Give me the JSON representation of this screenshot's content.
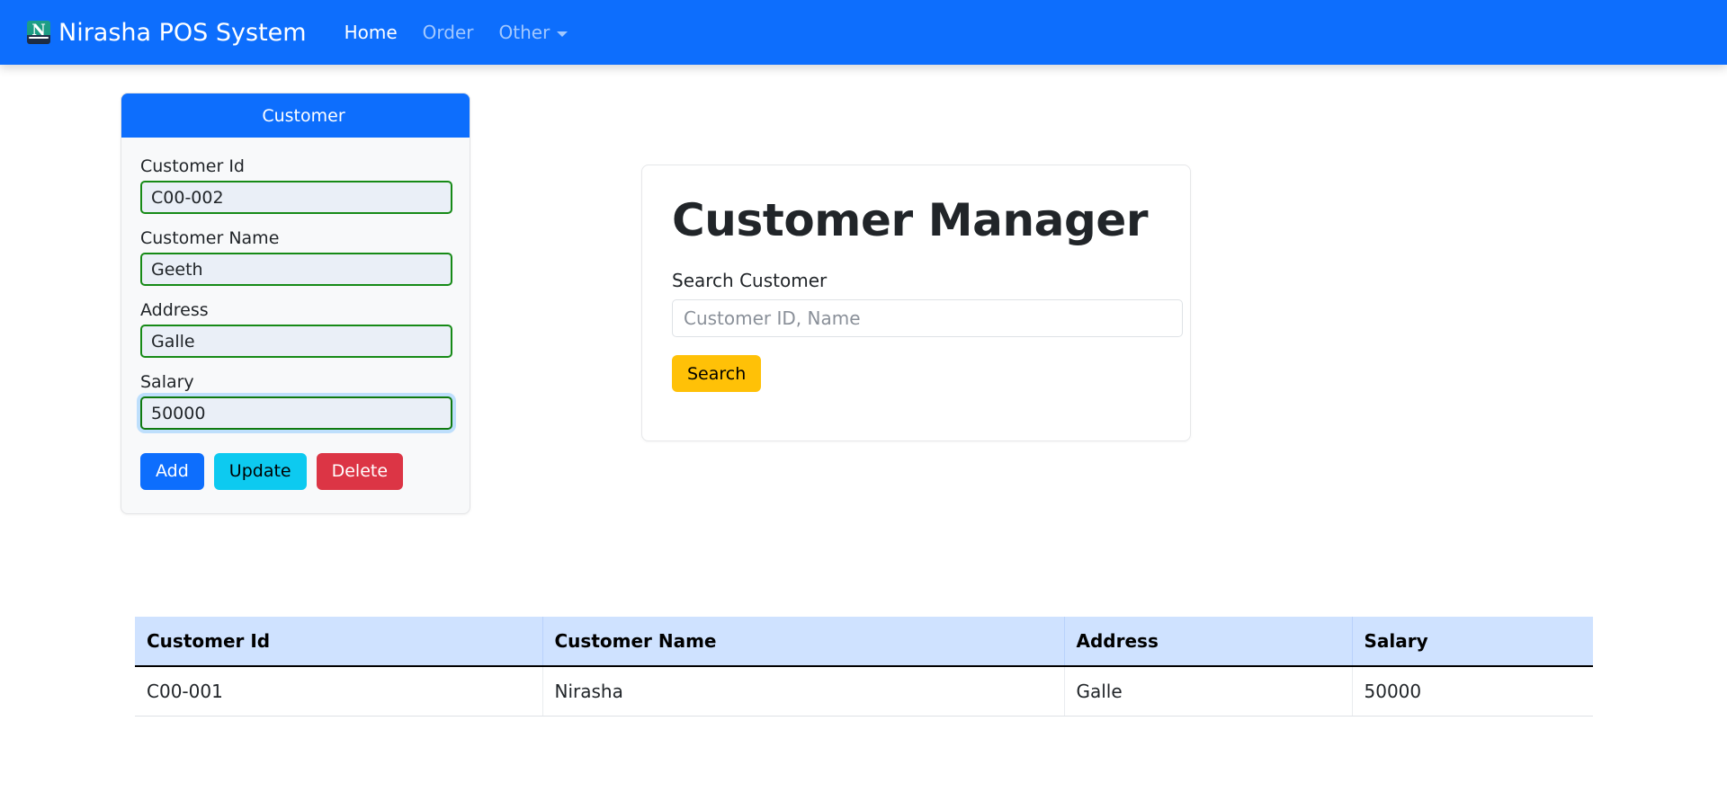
{
  "navbar": {
    "brand": "Nirasha POS System",
    "logo_icon": "logo-n-icon",
    "logo_letter": "N",
    "brand_color": "#0d6efd",
    "links": [
      {
        "label": "Home",
        "active": true,
        "has_caret": false
      },
      {
        "label": "Order",
        "active": false,
        "has_caret": false
      },
      {
        "label": "Other",
        "active": false,
        "has_caret": true
      }
    ]
  },
  "form_card": {
    "header": "Customer",
    "fields": [
      {
        "label": "Customer Id",
        "value": "C00-002",
        "focused": false
      },
      {
        "label": "Customer Name",
        "value": "Geeth",
        "focused": false
      },
      {
        "label": "Address",
        "value": "Galle",
        "focused": false
      },
      {
        "label": "Salary",
        "value": "50000",
        "focused": true
      }
    ],
    "buttons": {
      "add": "Add",
      "update": "Update",
      "delete": "Delete"
    },
    "colors": {
      "add": "#0d6efd",
      "update": "#0dcaf0",
      "delete": "#dc3545",
      "input_border": "#168a16",
      "input_fill": "#eaeff7"
    }
  },
  "manager_card": {
    "title": "Customer Manager",
    "search_label": "Search Customer",
    "search_placeholder": "Customer ID, Name",
    "search_value": "",
    "search_button": "Search",
    "search_button_color": "#ffc107"
  },
  "table": {
    "headers": [
      "Customer Id",
      "Customer Name",
      "Address",
      "Salary"
    ],
    "header_bg": "#cfe2ff",
    "rows": [
      {
        "id": "C00-001",
        "name": "Nirasha",
        "address": "Galle",
        "salary": "50000"
      }
    ]
  }
}
